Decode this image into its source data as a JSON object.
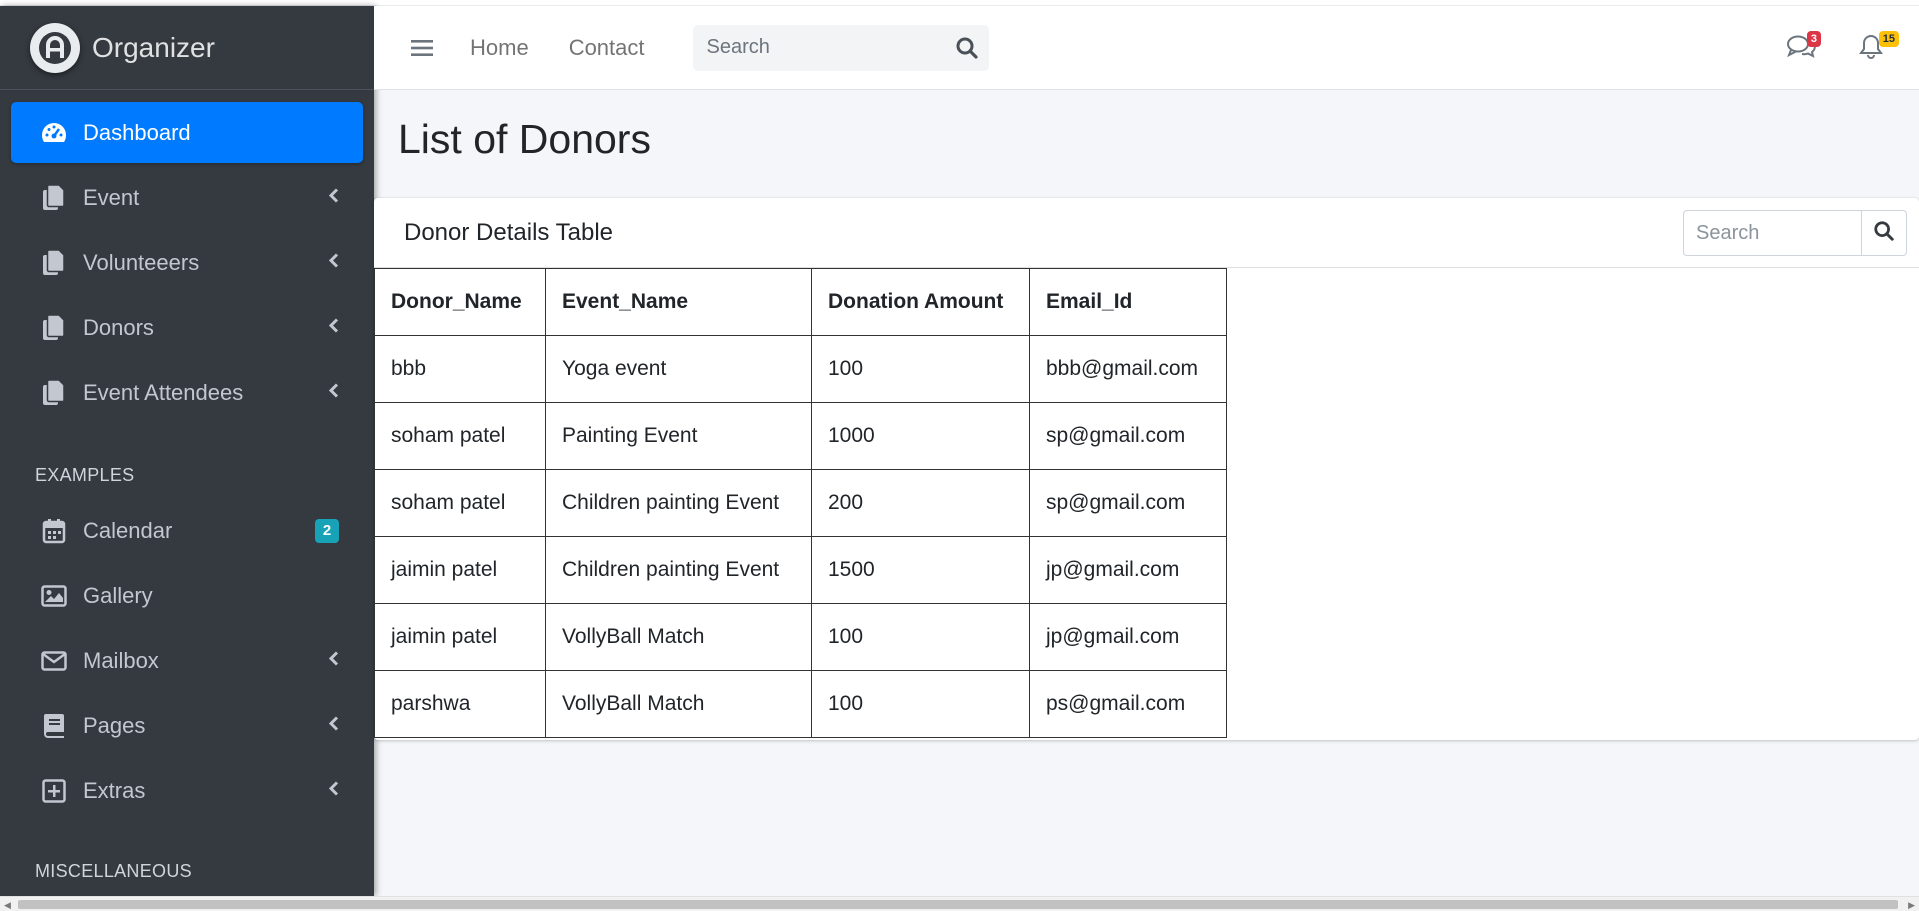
{
  "brand": {
    "name": "Organizer"
  },
  "sidebar": {
    "items": [
      {
        "label": "Dashboard",
        "icon": "tachometer-icon",
        "active": true
      },
      {
        "label": "Event",
        "icon": "copy-icon",
        "chevron": true
      },
      {
        "label": "Volunteeers",
        "icon": "copy-icon",
        "chevron": true
      },
      {
        "label": "Donors",
        "icon": "copy-icon",
        "chevron": true
      },
      {
        "label": "Event Attendees",
        "icon": "copy-icon",
        "chevron": true
      }
    ],
    "examples_header": "EXAMPLES",
    "examples": [
      {
        "label": "Calendar",
        "icon": "calendar-icon",
        "badge": "2"
      },
      {
        "label": "Gallery",
        "icon": "image-icon"
      },
      {
        "label": "Mailbox",
        "icon": "envelope-icon",
        "chevron": true
      },
      {
        "label": "Pages",
        "icon": "book-icon",
        "chevron": true
      },
      {
        "label": "Extras",
        "icon": "plus-square-icon",
        "chevron": true
      }
    ],
    "misc_header": "MISCELLANEOUS"
  },
  "navbar": {
    "links": [
      "Home",
      "Contact"
    ],
    "search_placeholder": "Search",
    "messages_count": "3",
    "notifications_count": "15"
  },
  "page": {
    "title": "List of Donors"
  },
  "card": {
    "title": "Donor Details Table",
    "search_placeholder": "Search"
  },
  "table": {
    "headers": [
      "Donor_Name",
      "Event_Name",
      "Donation Amount",
      "Email_Id"
    ],
    "rows": [
      [
        "bbb",
        "Yoga event",
        "100",
        "bbb@gmail.com"
      ],
      [
        "soham patel",
        "Painting Event",
        "1000",
        "sp@gmail.com"
      ],
      [
        "soham patel",
        "Children painting Event",
        "200",
        "sp@gmail.com"
      ],
      [
        "jaimin patel",
        "Children painting Event",
        "1500",
        "jp@gmail.com"
      ],
      [
        "jaimin patel",
        "VollyBall Match",
        "100",
        "jp@gmail.com"
      ],
      [
        "parshwa",
        "VollyBall Match",
        "100",
        "ps@gmail.com"
      ]
    ]
  },
  "colors": {
    "sidebar_bg": "#343a40",
    "active": "#007bff",
    "badge_info": "#17a2b8",
    "badge_danger": "#dc3545",
    "badge_warning": "#ffc107"
  }
}
